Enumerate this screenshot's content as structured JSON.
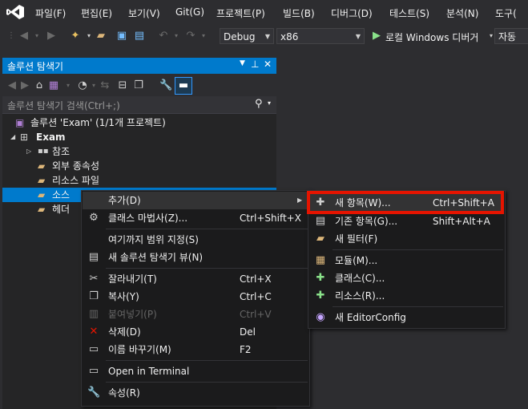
{
  "menu": [
    "파일(F)",
    "편집(E)",
    "보기(V)",
    "Git(G)",
    "프로젝트(P)",
    "빌드(B)",
    "디버그(D)",
    "테스트(S)",
    "분석(N)",
    "도구("
  ],
  "toolbar": {
    "config": "Debug",
    "platform": "x86",
    "run_label": "로컬 Windows 디버거",
    "auto": "자동"
  },
  "solution_explorer": {
    "title": "솔루션 탐색기",
    "search_placeholder": "솔루션 탐색기 검색(Ctrl+;)",
    "tree": {
      "solution": "솔루션 'Exam' (1/1개 프로젝트)",
      "project": "Exam",
      "references": "참조",
      "external": "외부 종속성",
      "resources": "리소스 파일",
      "source": "소스",
      "header": "헤더"
    }
  },
  "context_menu": {
    "items": [
      {
        "label": "추가(D)",
        "shortcut": ""
      },
      {
        "label": "클래스 마법사(Z)...",
        "shortcut": "Ctrl+Shift+X"
      },
      {
        "label": "여기까지 범위 지정(S)",
        "shortcut": ""
      },
      {
        "label": "새 솔루션 탐색기 뷰(N)",
        "shortcut": ""
      },
      {
        "label": "잘라내기(T)",
        "shortcut": "Ctrl+X"
      },
      {
        "label": "복사(Y)",
        "shortcut": "Ctrl+C"
      },
      {
        "label": "붙여넣기(P)",
        "shortcut": "Ctrl+V"
      },
      {
        "label": "삭제(D)",
        "shortcut": "Del"
      },
      {
        "label": "이름 바꾸기(M)",
        "shortcut": "F2"
      },
      {
        "label": "Open in Terminal",
        "shortcut": ""
      },
      {
        "label": "속성(R)",
        "shortcut": ""
      }
    ]
  },
  "submenu": {
    "items": [
      {
        "label": "새 항목(W)...",
        "shortcut": "Ctrl+Shift+A"
      },
      {
        "label": "기존 항목(G)...",
        "shortcut": "Shift+Alt+A"
      },
      {
        "label": "새 필터(F)",
        "shortcut": ""
      },
      {
        "label": "모듈(M)...",
        "shortcut": ""
      },
      {
        "label": "클래스(C)...",
        "shortcut": ""
      },
      {
        "label": "리소스(R)...",
        "shortcut": ""
      },
      {
        "label": "새 EditorConfig",
        "shortcut": ""
      }
    ],
    "highlight_color": "#e51400"
  },
  "colors": {
    "accent": "#007acc",
    "background": "#2d2d30",
    "panel": "#252526"
  }
}
